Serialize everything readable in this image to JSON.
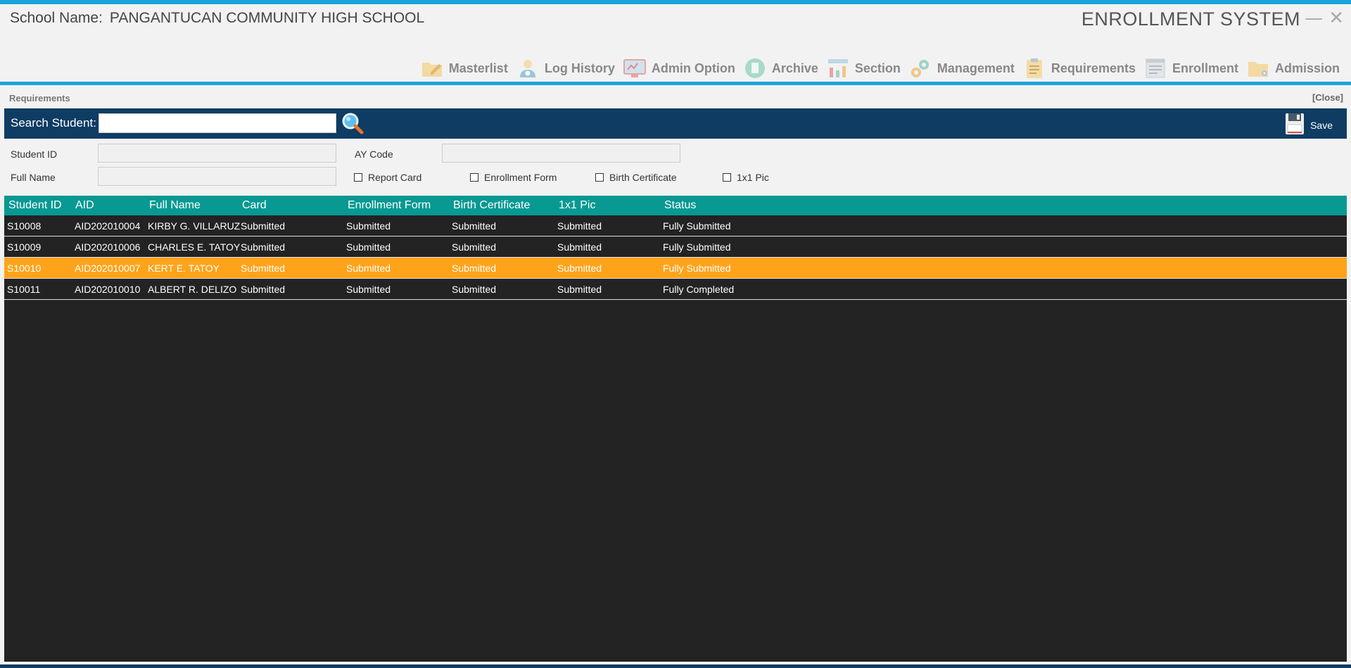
{
  "header": {
    "school_label": "School Name:",
    "school_name": "PANGANTUCAN COMMUNITY HIGH SCHOOL",
    "system_title": "ENROLLMENT SYSTEM",
    "minimize": "—",
    "close": "✕"
  },
  "nav": [
    {
      "label": "Masterlist",
      "icon": "folder-pen-icon"
    },
    {
      "label": "Log History",
      "icon": "user-clock-icon"
    },
    {
      "label": "Admin Option",
      "icon": "admin-screen-icon"
    },
    {
      "label": "Archive",
      "icon": "archive-doc-icon"
    },
    {
      "label": "Section",
      "icon": "section-chart-icon"
    },
    {
      "label": "Management",
      "icon": "gears-icon"
    },
    {
      "label": "Requirements",
      "icon": "clipboard-icon"
    },
    {
      "label": "Enrollment",
      "icon": "form-icon"
    },
    {
      "label": "Admission",
      "icon": "folder-gear-icon"
    }
  ],
  "panel": {
    "title": "Requirements",
    "close_label": "[Close]"
  },
  "search": {
    "label": "Search Student:",
    "value": "",
    "save_label": "Save"
  },
  "form": {
    "student_id_label": "Student ID",
    "full_name_label": "Full Name",
    "ay_code_label": "AY Code",
    "checks": [
      "Report Card",
      "Enrollment Form",
      "Birth Certificate",
      "1x1 Pic"
    ]
  },
  "grid": {
    "columns": [
      "Student ID",
      "AID",
      "Full Name",
      "Card",
      "Enrollment Form",
      "Birth Certificate",
      "1x1 Pic",
      "Status"
    ],
    "rows": [
      [
        "S10008",
        "AID202010004",
        "KIRBY G. VILLARUZ",
        "Submitted",
        "Submitted",
        "Submitted",
        "Submitted",
        "Fully Submitted"
      ],
      [
        "S10009",
        "AID202010006",
        "CHARLES E. TATOY",
        "Submitted",
        "Submitted",
        "Submitted",
        "Submitted",
        "Fully Submitted"
      ],
      [
        "S10010",
        "AID202010007",
        "KERT E. TATOY",
        "Submitted",
        "Submitted",
        "Submitted",
        "Submitted",
        "Fully Submitted"
      ],
      [
        "S10011",
        "AID202010010",
        "ALBERT R. DELIZO",
        "Submitted",
        "Submitted",
        "Submitted",
        "Submitted",
        "Fully Completed"
      ]
    ],
    "selected_row": 2
  },
  "colors": {
    "accent": "#1aa3dc",
    "header_bar": "#0e3c63",
    "grid_header": "#079992",
    "grid_bg": "#232323",
    "selected": "#ffa31a"
  }
}
